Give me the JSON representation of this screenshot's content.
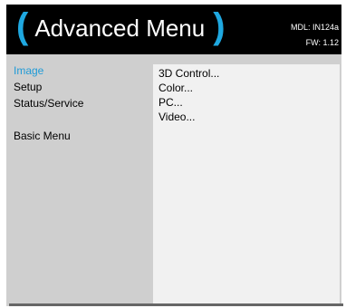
{
  "header": {
    "open_paren": "(",
    "title": "Advanced Menu",
    "close_paren": ")",
    "model": "MDL: IN124a",
    "firmware": "FW: 1.12"
  },
  "left_menu": {
    "items": [
      {
        "label": "Image",
        "active": true
      },
      {
        "label": "Setup"
      },
      {
        "label": "Status/Service"
      },
      {
        "label": "Basic Menu"
      }
    ]
  },
  "submenu": {
    "items": [
      {
        "label": "3D Control..."
      },
      {
        "label": "Color..."
      },
      {
        "label": "PC..."
      },
      {
        "label": "Video..."
      }
    ]
  },
  "colors": {
    "accent": "#1fa8e0",
    "header_bg": "#000000",
    "panel_bg": "#cfcfcf",
    "submenu_bg": "#f1f1f1"
  }
}
